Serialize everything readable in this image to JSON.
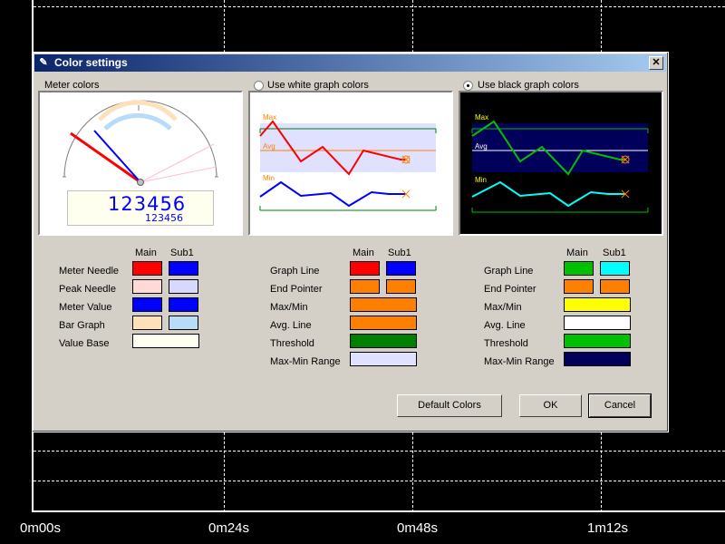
{
  "background": {
    "time_labels": [
      "0m00s",
      "0m24s",
      "0m48s",
      "1m12s"
    ]
  },
  "dialog": {
    "title": "Color settings",
    "close_glyph": "✕",
    "sections": {
      "meter": "Meter colors",
      "white": "Use white graph colors",
      "black": "Use black graph colors"
    },
    "selected_scheme": "black",
    "meter_preview": {
      "main_value": "123456",
      "sub_value": "123456"
    },
    "graph_labels": {
      "max": "Max",
      "avg": "Avg",
      "min": "Min"
    },
    "headers": {
      "main": "Main",
      "sub": "Sub1"
    },
    "meter_rows": [
      {
        "label": "Meter Needle",
        "main": "#ff0000",
        "sub": "#0000ff"
      },
      {
        "label": "Peak Needle",
        "main": "#ffd8d8",
        "sub": "#d8d8ff"
      },
      {
        "label": "Meter Value",
        "main": "#0000ff",
        "sub": "#0000ff"
      },
      {
        "label": "Bar Graph",
        "main": "#ffe0b8",
        "sub": "#b8dcf8"
      },
      {
        "label": "Value Base",
        "main": "#fffff0"
      }
    ],
    "white_rows": [
      {
        "label": "Graph Line",
        "main": "#ff0000",
        "sub": "#0000ff"
      },
      {
        "label": "End Pointer",
        "main": "#ff8000",
        "sub": "#ff8000"
      },
      {
        "label": "Max/Min",
        "main": "#ff8000"
      },
      {
        "label": "Avg. Line",
        "main": "#ff8000"
      },
      {
        "label": "Threshold",
        "main": "#008000"
      },
      {
        "label": "Max-Min Range",
        "main": "#e0e0ff"
      }
    ],
    "black_rows": [
      {
        "label": "Graph Line",
        "main": "#00c000",
        "sub": "#00ffff"
      },
      {
        "label": "End Pointer",
        "main": "#ff8000",
        "sub": "#ff8000"
      },
      {
        "label": "Max/Min",
        "main": "#ffff00"
      },
      {
        "label": "Avg. Line",
        "main": "#ffffff"
      },
      {
        "label": "Threshold",
        "main": "#00c000"
      },
      {
        "label": "Max-Min Range",
        "main": "#00005a"
      }
    ],
    "buttons": {
      "default": "Default Colors",
      "ok": "OK",
      "cancel": "Cancel"
    }
  }
}
